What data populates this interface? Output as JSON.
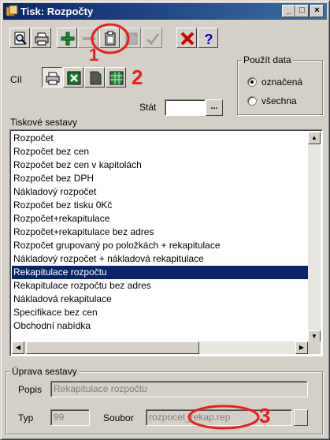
{
  "window": {
    "title": "Tisk: Rozpočty",
    "minimize": "_",
    "maximize": "□",
    "close": "×"
  },
  "toolbar": {
    "buttons": [
      {
        "icon": "print-preview-icon",
        "enabled": true
      },
      {
        "icon": "printer-icon",
        "enabled": true
      },
      {
        "icon": "plus-icon",
        "enabled": true
      },
      {
        "icon": "minus-icon",
        "enabled": false
      },
      {
        "icon": "clipboard-icon",
        "enabled": true
      },
      {
        "icon": "report-icon",
        "enabled": false
      },
      {
        "icon": "check-icon",
        "enabled": false
      },
      {
        "icon": "delete-icon",
        "enabled": true
      },
      {
        "icon": "help-icon",
        "enabled": true
      }
    ]
  },
  "annotations": {
    "m1": "1",
    "m2": "2",
    "m3": "3"
  },
  "target": {
    "label": "Cíl"
  },
  "use_data": {
    "legend": "Použít data",
    "options": [
      "označená",
      "všechna"
    ],
    "selected": "označená"
  },
  "state": {
    "label": "Stát",
    "value": "",
    "browse_label": "..."
  },
  "reports": {
    "label": "Tiskové sestavy",
    "items": [
      "Rozpočet",
      "Rozpočet bez cen",
      "Rozpočet bez cen v kapitolách",
      "Rozpočet bez DPH",
      "Nákladový rozpočet",
      "Rozpočet bez tisku 0Kč",
      "Rozpočet+rekapitulace",
      "Rozpočet+rekapitulace bez adres",
      "Rozpočet grupovaný po položkách + rekapitulace",
      "Nákladový rozpočet + nákladová rekapitulace",
      "Rekapitulace rozpočtu",
      "Rekapitulace rozpočtu bez adres",
      "Nákladová rekapitulace",
      "Specifikace bez cen",
      "Obchodní nabídka"
    ],
    "selected": "Rekapitulace rozpočtu"
  },
  "edit": {
    "legend": "Úprava sestavy",
    "popis_label": "Popis",
    "popis_value": "Rekapitulace rozpočtu",
    "typ_label": "Typ",
    "typ_value": "99",
    "soubor_label": "Soubor",
    "soubor_value": "rozpocet_rekap.rep"
  }
}
